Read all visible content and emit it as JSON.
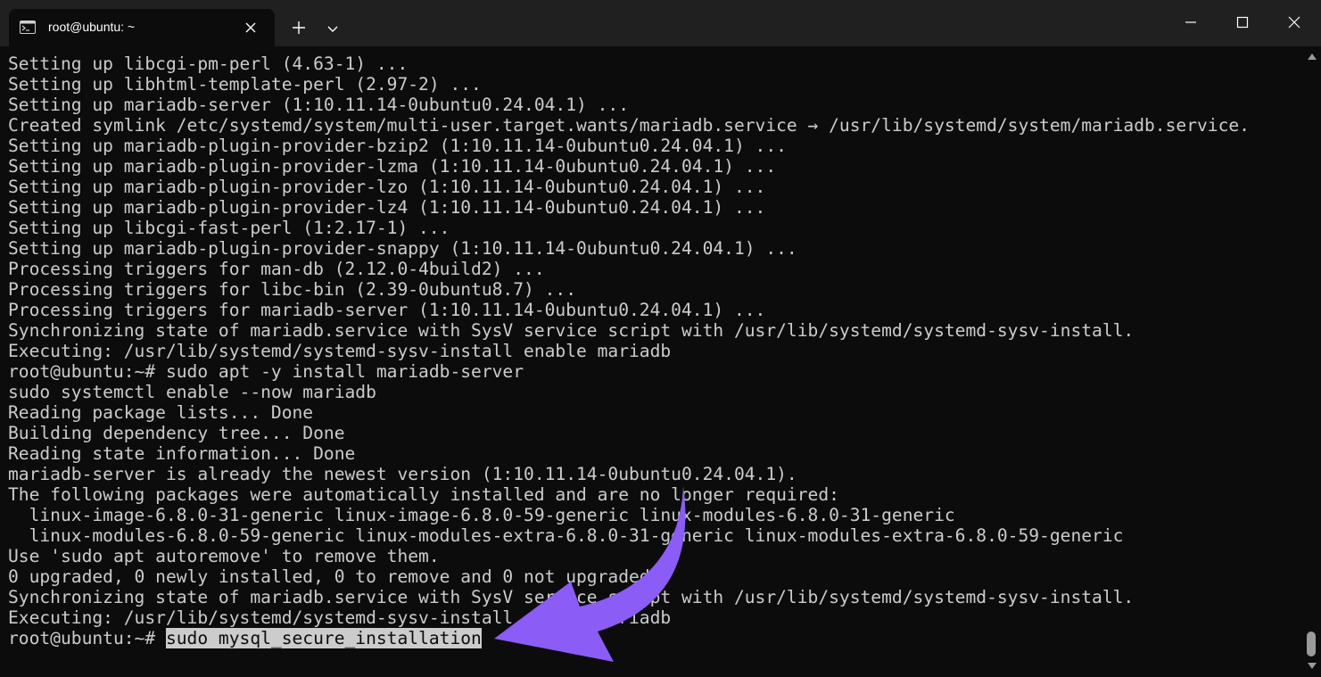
{
  "window": {
    "tab_title": "root@ubuntu: ~"
  },
  "icons": {
    "tab_icon": "terminal-icon",
    "tab_close": "close-icon",
    "new_tab": "plus-icon",
    "dropdown": "chevron-down-icon",
    "minimize": "minimize-icon",
    "maximize": "maximize-icon",
    "close": "close-icon"
  },
  "colors": {
    "background": "#0c0c0c",
    "text": "#cccccc",
    "titlebar": "#202020",
    "annotation_arrow": "#8b5cf6"
  },
  "terminal": {
    "lines": [
      "Setting up libcgi-pm-perl (4.63-1) ...",
      "Setting up libhtml-template-perl (2.97-2) ...",
      "Setting up mariadb-server (1:10.11.14-0ubuntu0.24.04.1) ...",
      "Created symlink /etc/systemd/system/multi-user.target.wants/mariadb.service → /usr/lib/systemd/system/mariadb.service.",
      "Setting up mariadb-plugin-provider-bzip2 (1:10.11.14-0ubuntu0.24.04.1) ...",
      "Setting up mariadb-plugin-provider-lzma (1:10.11.14-0ubuntu0.24.04.1) ...",
      "Setting up mariadb-plugin-provider-lzo (1:10.11.14-0ubuntu0.24.04.1) ...",
      "Setting up mariadb-plugin-provider-lz4 (1:10.11.14-0ubuntu0.24.04.1) ...",
      "Setting up libcgi-fast-perl (1:2.17-1) ...",
      "Setting up mariadb-plugin-provider-snappy (1:10.11.14-0ubuntu0.24.04.1) ...",
      "Processing triggers for man-db (2.12.0-4build2) ...",
      "Processing triggers for libc-bin (2.39-0ubuntu8.7) ...",
      "Processing triggers for mariadb-server (1:10.11.14-0ubuntu0.24.04.1) ...",
      "Synchronizing state of mariadb.service with SysV service script with /usr/lib/systemd/systemd-sysv-install.",
      "Executing: /usr/lib/systemd/systemd-sysv-install enable mariadb",
      "root@ubuntu:~# sudo apt -y install mariadb-server",
      "sudo systemctl enable --now mariadb",
      "Reading package lists... Done",
      "Building dependency tree... Done",
      "Reading state information... Done",
      "mariadb-server is already the newest version (1:10.11.14-0ubuntu0.24.04.1).",
      "The following packages were automatically installed and are no longer required:",
      "  linux-image-6.8.0-31-generic linux-image-6.8.0-59-generic linux-modules-6.8.0-31-generic",
      "  linux-modules-6.8.0-59-generic linux-modules-extra-6.8.0-31-generic linux-modules-extra-6.8.0-59-generic",
      "Use 'sudo apt autoremove' to remove them.",
      "0 upgraded, 0 newly installed, 0 to remove and 0 not upgraded.",
      "Synchronizing state of mariadb.service with SysV service script with /usr/lib/systemd/systemd-sysv-install.",
      "Executing: /usr/lib/systemd/systemd-sysv-install enable mariadb"
    ],
    "prompt": "root@ubuntu:~# ",
    "current_command": "sudo mysql_secure_installation"
  }
}
